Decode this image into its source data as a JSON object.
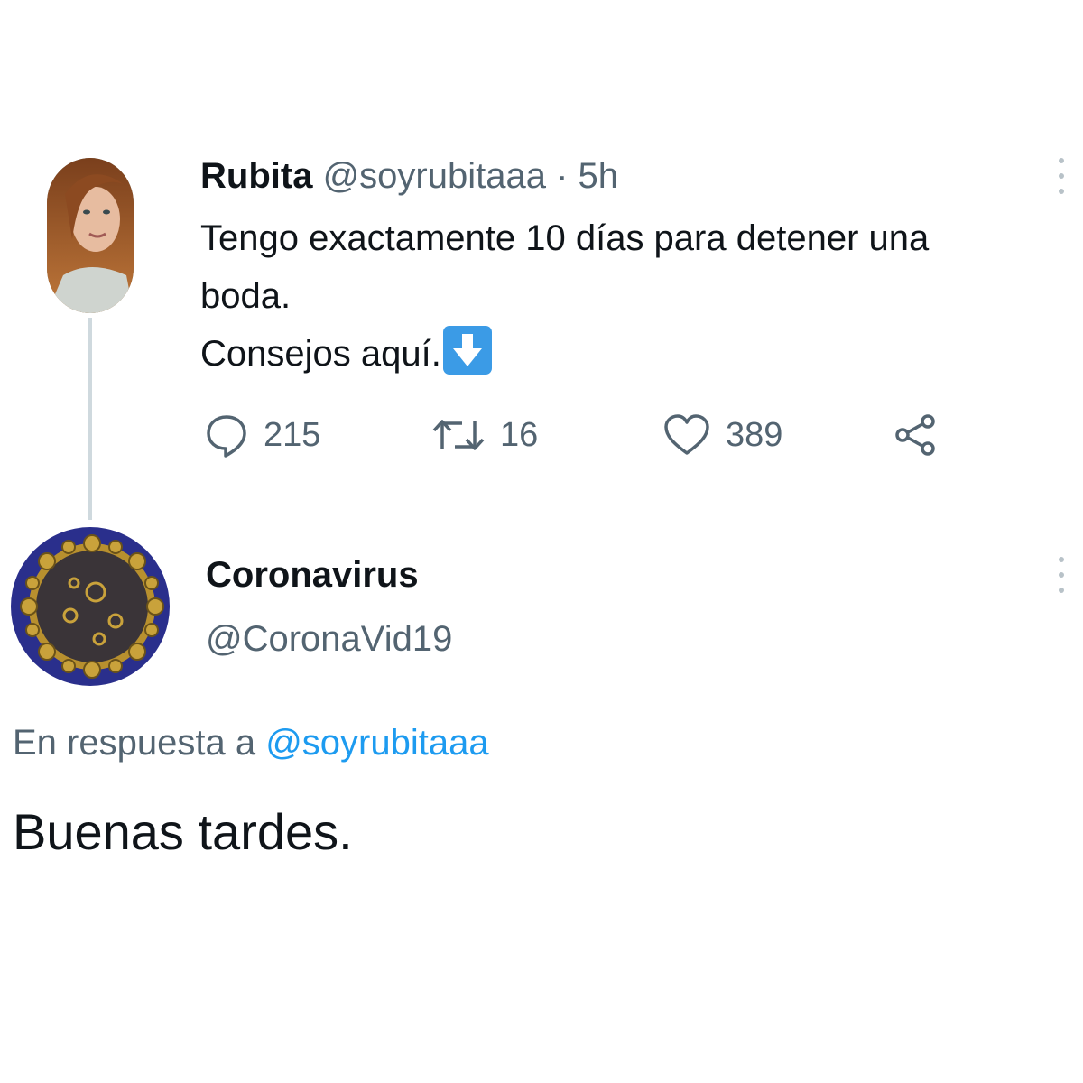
{
  "tweet": {
    "author_name": "Rubita",
    "author_handle": "@soyrubitaaa",
    "separator": "·",
    "time": "5h",
    "text_lines": [
      "Tengo exactamente 10 días para detener una",
      "boda.",
      "Consejos aquí."
    ],
    "emoji": "down-arrow-emoji",
    "actions": {
      "replies": "215",
      "retweets": "16",
      "likes": "389"
    }
  },
  "reply": {
    "author_name": "Coronavirus",
    "author_handle": "@CoronaVid19",
    "in_reply_to_prefix": "En respuesta a",
    "in_reply_to_handle": "@soyrubitaaa",
    "text": "Buenas tardes."
  },
  "colors": {
    "text_primary": "#0f1419",
    "text_secondary": "#536471",
    "link": "#1d9bf0",
    "thread_line": "#cfd9de",
    "emoji_bg": "#3b9be6"
  },
  "icons": [
    "more-icon",
    "reply-icon",
    "retweet-icon",
    "like-icon",
    "share-icon"
  ]
}
